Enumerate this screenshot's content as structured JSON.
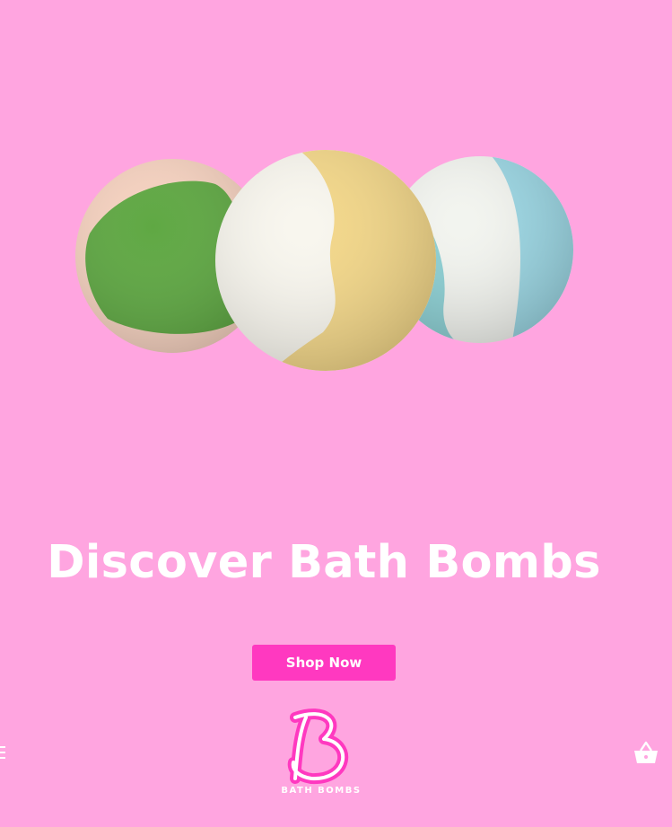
{
  "hero": {
    "title": "Discover Bath Bombs",
    "cta_label": "Shop Now",
    "image": "three-bath-bombs-image"
  },
  "footer": {
    "menu_icon": "hamburger-menu-icon",
    "logo_text": "BATH BOMBS",
    "cart_icon": "shopping-basket-icon"
  },
  "colors": {
    "background": "#ffa5e0",
    "accent": "#ff39c0",
    "text": "#ffffff"
  }
}
